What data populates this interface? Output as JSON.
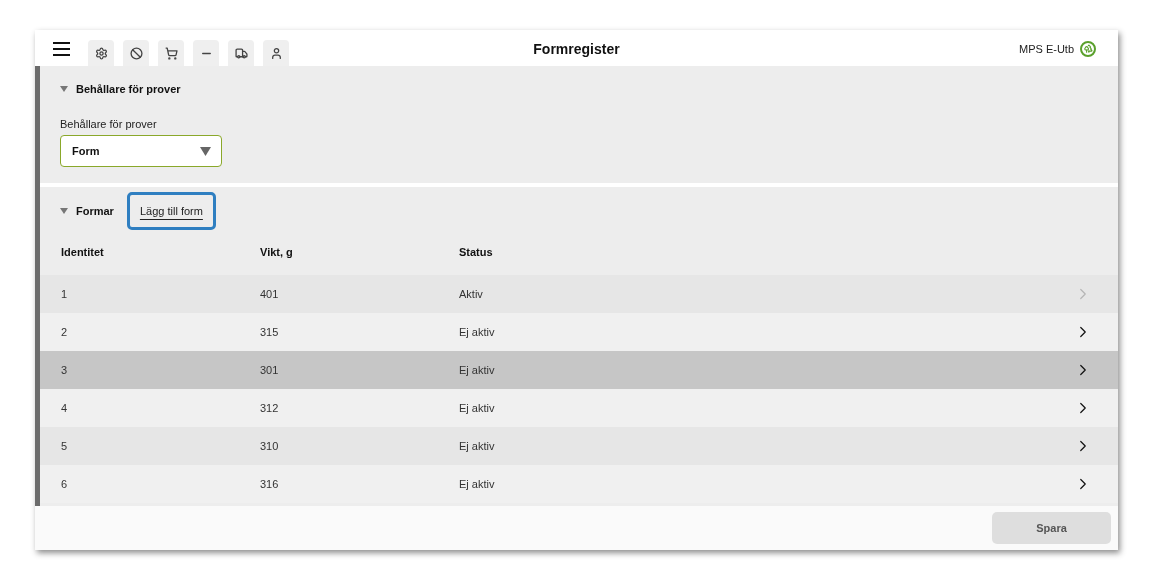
{
  "window": {
    "title": "Formregister",
    "user": "MPS E-Utb"
  },
  "toolbar_tabs": [
    {
      "selected": false
    },
    {
      "selected": false
    },
    {
      "selected": false
    },
    {
      "selected": false
    },
    {
      "selected": false
    },
    {
      "selected": false
    }
  ],
  "container_section": {
    "title": "Behållare för prover",
    "expanded": true,
    "field_label": "Behållare för prover",
    "value": "Form"
  },
  "forms_section": {
    "title": "Formar",
    "expanded": true,
    "add_button": "Lägg till form",
    "columns": [
      "Identitet",
      "Vikt, g",
      "Status"
    ],
    "rows": [
      {
        "id": "1",
        "weight": "401",
        "status": "Aktiv",
        "selected": false,
        "disabled": true
      },
      {
        "id": "2",
        "weight": "315",
        "status": "Ej aktiv",
        "selected": false,
        "disabled": false
      },
      {
        "id": "3",
        "weight": "301",
        "status": "Ej aktiv",
        "selected": true,
        "disabled": false
      },
      {
        "id": "4",
        "weight": "312",
        "status": "Ej aktiv",
        "selected": false,
        "disabled": false
      },
      {
        "id": "5",
        "weight": "310",
        "status": "Ej aktiv",
        "selected": false,
        "disabled": false
      },
      {
        "id": "6",
        "weight": "316",
        "status": "Ej aktiv",
        "selected": false,
        "disabled": false
      }
    ]
  },
  "save_button": "Spara"
}
